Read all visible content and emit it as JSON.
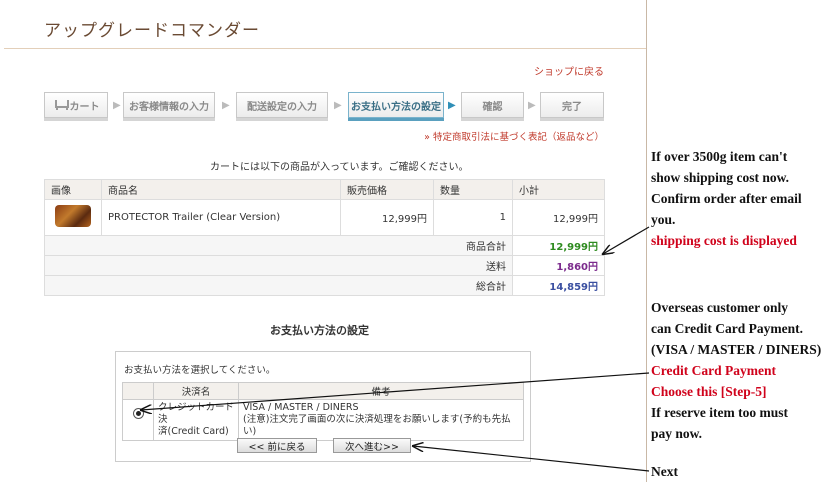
{
  "header": {
    "title": "アップグレードコマンダー",
    "shop_link": "ショップに戻る"
  },
  "steps": [
    {
      "label": "カート",
      "active": false
    },
    {
      "label": "お客様情報の入力",
      "active": false
    },
    {
      "label": "配送設定の入力",
      "active": false
    },
    {
      "label": "お支払い方法の設定",
      "active": true
    },
    {
      "label": "確認",
      "active": false
    },
    {
      "label": "完了",
      "active": false
    }
  ],
  "tokutei_link": "» 特定商取引法に基づく表記（返品など）",
  "cart": {
    "intro": "カートには以下の商品が入っています。ご確認ください。",
    "headers": [
      "画像",
      "商品名",
      "販売価格",
      "数量",
      "小計"
    ],
    "item": {
      "name": "PROTECTOR Trailer (Clear Version)",
      "price": "12,999円",
      "qty": "1",
      "subtotal": "12,999円"
    },
    "subtotal_label": "商品合計",
    "subtotal_value": "12,999円",
    "shipping_label": "送料",
    "shipping_value": "1,860円",
    "total_label": "総合計",
    "total_value": "14,859円",
    "colors": {
      "subtotal": "#2e8b1f",
      "shipping": "#7b2a8c",
      "total": "#3a4fa0"
    }
  },
  "payment": {
    "title": "お支払い方法の設定",
    "instruction": "お支払い方法を選択してください。",
    "headers": [
      "決済名",
      "備考"
    ],
    "method_line1": "クレジットカード決",
    "method_line2": "済(Credit Card)",
    "note_line1": "VISA / MASTER / DINERS",
    "note_line2": "(注意)注文完了画面の次に決済処理をお願いします(予約も先払い)",
    "back_button": "<< 前に戻る",
    "next_button": "次へ進む>>"
  },
  "annotations": {
    "a1": [
      "If over 3500g item can't",
      "show shipping cost now.",
      "Confirm order after email",
      "you."
    ],
    "a1_red": "shipping cost is displayed",
    "a2": [
      "Overseas customer only",
      "can Credit Card Payment.",
      "(VISA / MASTER / DINERS)"
    ],
    "a2_red": [
      "Credit Card Payment",
      "Choose this [Step-5]"
    ],
    "a2_tail": [
      "If reserve item too must",
      "pay now."
    ],
    "a3_red": "Next"
  }
}
